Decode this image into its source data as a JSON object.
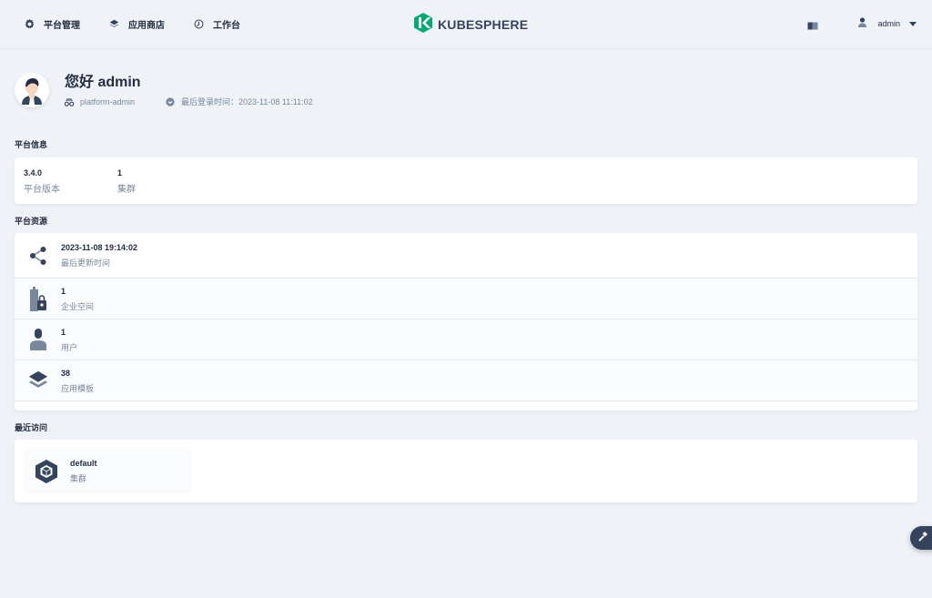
{
  "nav": {
    "items": [
      {
        "label": "平台管理",
        "icon": "gear-icon"
      },
      {
        "label": "应用商店",
        "icon": "app-store-icon"
      },
      {
        "label": "工作台",
        "icon": "workbench-icon"
      }
    ],
    "logo_text": "KUBESPHERE",
    "user": "admin"
  },
  "profile": {
    "greeting": "您好 admin",
    "role": "platform-admin",
    "last_login": "最后登录时间：2023-11-08 11:11:02"
  },
  "platform_info": {
    "title": "平台信息",
    "items": [
      {
        "value": "3.4.0",
        "label": "平台版本"
      },
      {
        "value": "1",
        "label": "集群"
      }
    ]
  },
  "platform_resources": {
    "title": "平台资源",
    "items": [
      {
        "value": "2023-11-08 19:14:02",
        "label": "最后更新时间",
        "icon": "share-nodes-icon"
      },
      {
        "value": "1",
        "label": "企业空间",
        "icon": "workspace-icon"
      },
      {
        "value": "1",
        "label": "用户",
        "icon": "user-icon"
      },
      {
        "value": "38",
        "label": "应用模板",
        "icon": "layers-icon"
      }
    ]
  },
  "recent": {
    "title": "最近访问",
    "items": [
      {
        "name": "default",
        "label": "集群",
        "icon": "cluster-icon"
      }
    ]
  },
  "colors": {
    "background": "#eff3f7",
    "text_primary": "#242e42",
    "text_secondary": "#79879c",
    "brand_green": "#00aa72",
    "tool_button": "#36435c"
  }
}
